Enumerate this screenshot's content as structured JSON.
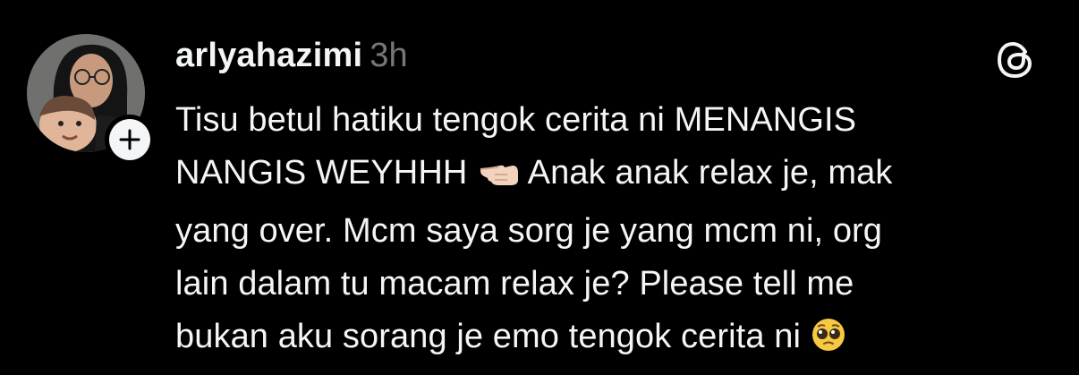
{
  "post": {
    "author": {
      "username": "arlyahazimi",
      "timestamp": "3h",
      "follow_icon": "plus-icon"
    },
    "app_icon": "threads-logo-icon",
    "text_lines": [
      "Tisu betul hatiku tengok cerita ni MENANGIS",
      "NANGIS WEYHHH",
      "Anak anak relax je, mak",
      "yang over. Mcm saya sorg je yang mcm ni, org",
      "lain dalam tu macam relax je? Please tell me",
      "bukan aku sorang je emo tengok cerita ni"
    ],
    "emojis": [
      "pointing-left-hand-emoji",
      "pleading-face-emoji"
    ]
  },
  "colors": {
    "background": "#000000",
    "text": "#f3f5f7",
    "timestamp": "#777777"
  }
}
